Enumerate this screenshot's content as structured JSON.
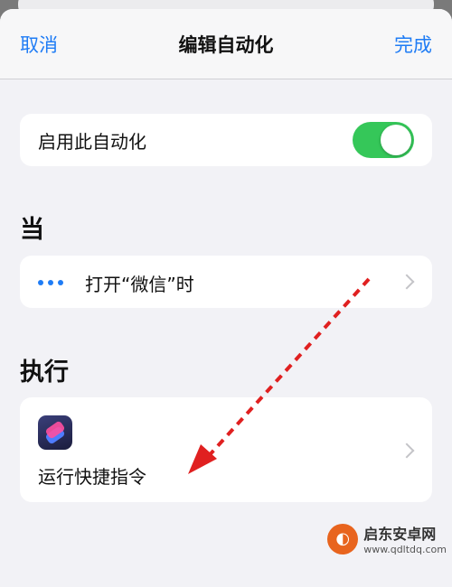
{
  "navbar": {
    "cancel_label": "取消",
    "title": "编辑自动化",
    "done_label": "完成"
  },
  "toggle": {
    "label": "启用此自动化",
    "enabled": true,
    "on_color": "#35c759"
  },
  "sections": {
    "when_header": "当",
    "do_header": "执行"
  },
  "trigger": {
    "icon": "ellipsis-icon",
    "label": "打开“微信”时"
  },
  "action": {
    "icon": "shortcuts-app-icon",
    "label": "运行快捷指令"
  },
  "annotation": {
    "type": "dashed-arrow",
    "color": "#e02020"
  },
  "watermark": {
    "title": "启东安卓网",
    "url": "www.qdltdq.com"
  },
  "colors": {
    "accent": "#1f7cf5",
    "background": "#f2f2f6"
  }
}
